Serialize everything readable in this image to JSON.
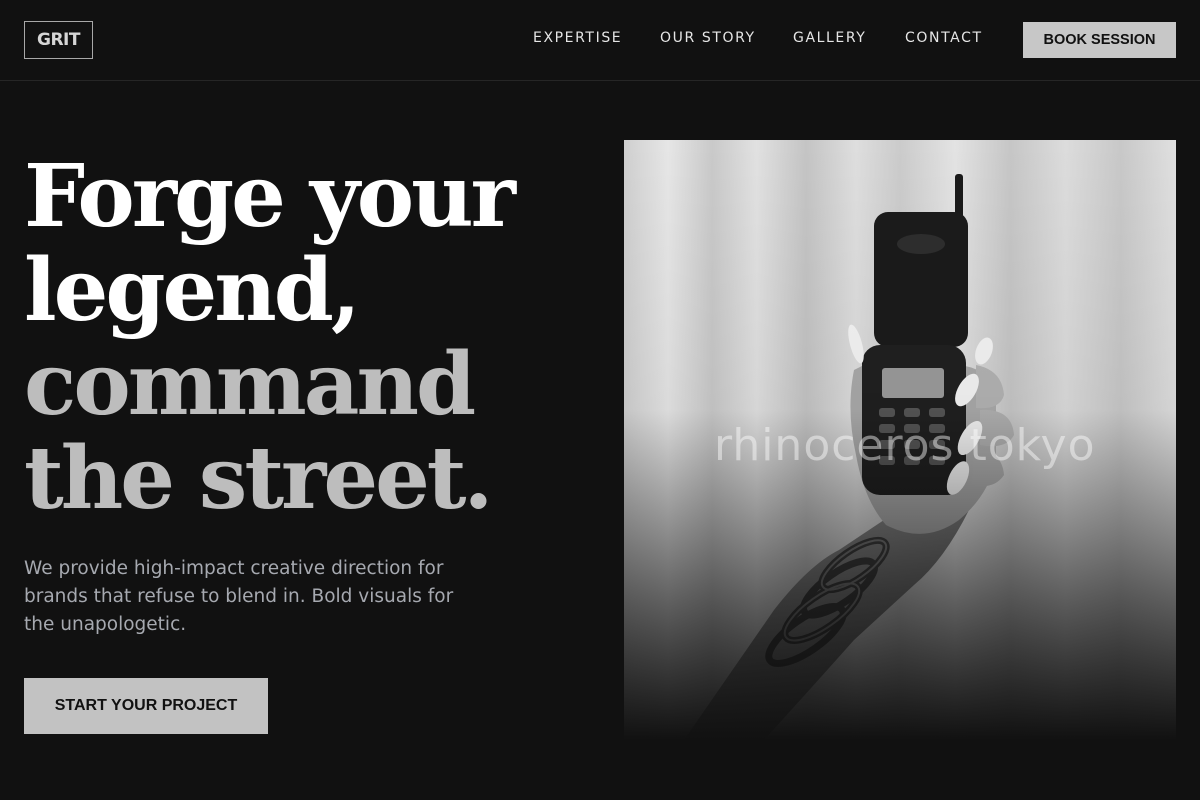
{
  "header": {
    "logo": "GRIT",
    "nav": [
      "EXPERTISE",
      "OUR STORY",
      "GALLERY",
      "CONTACT"
    ],
    "cta_label": "BOOK SESSION"
  },
  "hero": {
    "headline_lines": [
      "Forge your",
      "legend,",
      "command",
      "the street."
    ],
    "description": "We provide high-impact creative direction for brands that refuse to blend in. Bold visuals for the unapologetic.",
    "cta_label": "START YOUR PROJECT",
    "image": {
      "description": "phone-in-hand-photo",
      "watermark": "rhinoceros tokyo"
    }
  },
  "colors": {
    "background": "#111111",
    "headline_primary": "#ffffff",
    "headline_secondary": "#bdbdbd",
    "body_text": "#a6a9b0",
    "button_bg": "#c2c2c2",
    "button_text": "#111111"
  }
}
